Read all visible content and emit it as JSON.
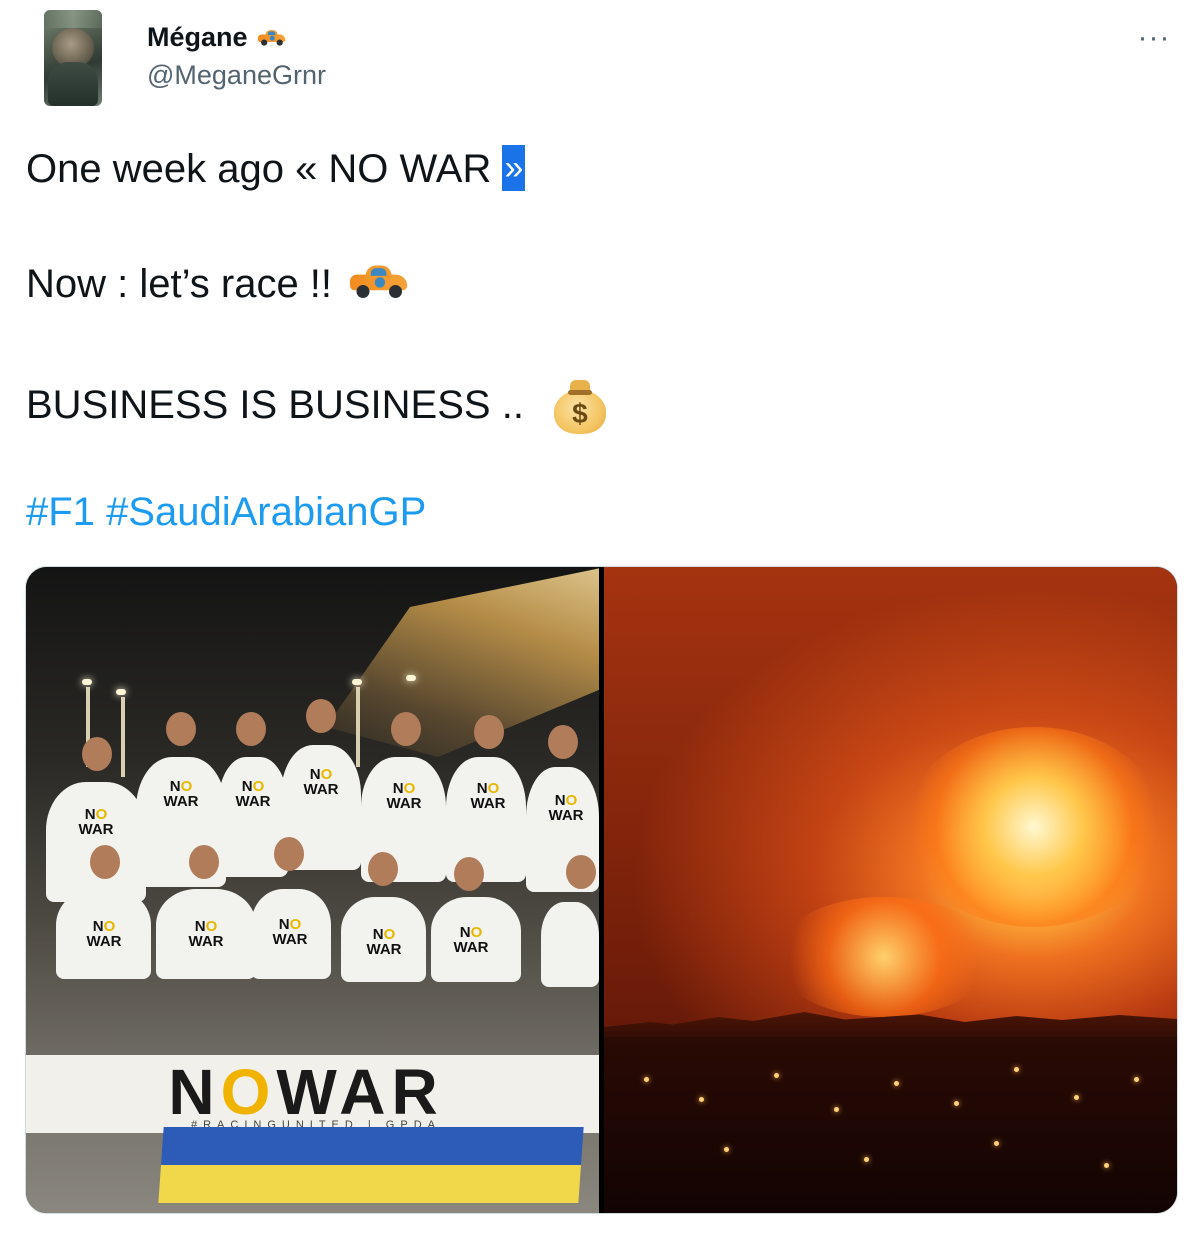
{
  "author": {
    "display_name": "Mégane",
    "handle": "@MeganeGrnr",
    "name_emoji": "race-car-icon"
  },
  "menu": {
    "more_label": "···"
  },
  "tweet": {
    "line1_text": "One week ago  «  NO WAR ",
    "line1_close_quote": "»",
    "line2_text": "Now : let’s race !!",
    "line2_emoji": "race-car-icon",
    "line3_text": "BUSINESS IS BUSINESS ..",
    "line3_emoji": "money-bag-icon",
    "money_symbol": "$",
    "hashtags": [
      "#F1",
      "#SaudiArabianGP"
    ]
  },
  "media": {
    "left_photo": {
      "shirt_text_top": "N",
      "shirt_text_o": "O",
      "shirt_text_bottom": "WAR",
      "banner_text_n": "N",
      "banner_text_o": "O",
      "banner_text_rest": "WAR",
      "banner_subtext": "#RACINGUNITED  |  GPDA",
      "flag_colors": [
        "#2c5bb8",
        "#f1d84a"
      ]
    },
    "right_photo": {
      "description_colors": [
        "#ffb43a",
        "#e8641a",
        "#3a0b04"
      ]
    }
  },
  "colors": {
    "link": "#1d9bf0",
    "text": "#0f1419",
    "secondary": "#536471",
    "highlight": "#1a73e8"
  }
}
